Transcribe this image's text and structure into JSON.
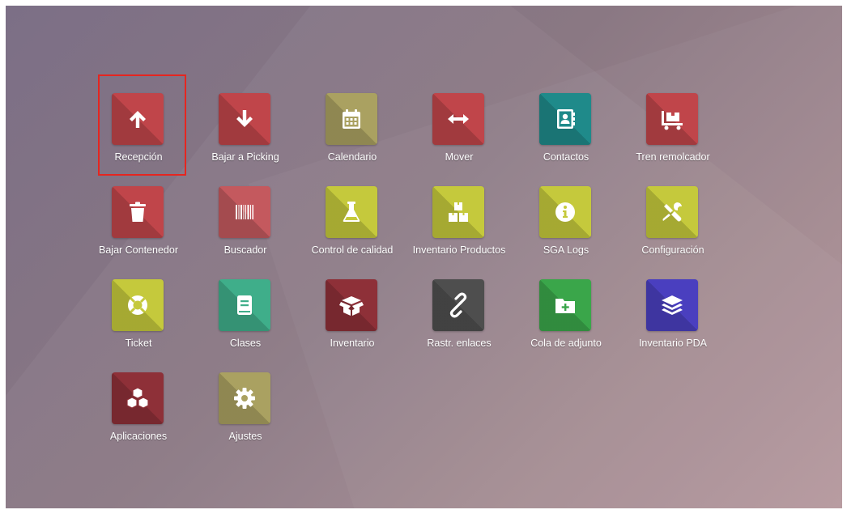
{
  "apps": [
    {
      "label": "Recepción",
      "icon": "arrow-up-icon",
      "color": "#c0454a"
    },
    {
      "label": "Bajar a Picking",
      "icon": "arrow-down-icon",
      "color": "#c0454a"
    },
    {
      "label": "Calendario",
      "icon": "calendar-icon",
      "color": "#aaa161"
    },
    {
      "label": "Mover",
      "icon": "arrows-horizontal-icon",
      "color": "#c0454a"
    },
    {
      "label": "Contactos",
      "icon": "address-book-icon",
      "color": "#1f8a8a"
    },
    {
      "label": "Tren remolcador",
      "icon": "pallet-cart-icon",
      "color": "#c0454a"
    },
    {
      "label": "Bajar Contenedor",
      "icon": "trash-icon",
      "color": "#c0454a"
    },
    {
      "label": "Buscador",
      "icon": "barcode-icon",
      "color": "#c4595e"
    },
    {
      "label": "Control de calidad",
      "icon": "flask-icon",
      "color": "#c5c93c"
    },
    {
      "label": "Inventario Productos",
      "icon": "boxes-icon",
      "color": "#c5c93c"
    },
    {
      "label": "SGA Logs",
      "icon": "info-icon",
      "color": "#c5c93c"
    },
    {
      "label": "Configuración",
      "icon": "tools-icon",
      "color": "#c5c93c"
    },
    {
      "label": "Ticket",
      "icon": "lifebuoy-icon",
      "color": "#c5c93c"
    },
    {
      "label": "Clases",
      "icon": "book-icon",
      "color": "#3fae8a"
    },
    {
      "label": "Inventario",
      "icon": "open-box-icon",
      "color": "#8e3038"
    },
    {
      "label": "Rastr. enlaces",
      "icon": "link-icon",
      "color": "#4e4e4e"
    },
    {
      "label": "Cola de adjunto",
      "icon": "folder-plus-icon",
      "color": "#3aa64a"
    },
    {
      "label": "Inventario PDA",
      "icon": "layers-icon",
      "color": "#4a3fbf"
    },
    {
      "label": "Aplicaciones",
      "icon": "cubes-icon",
      "color": "#8e3038"
    },
    {
      "label": "Ajustes",
      "icon": "gear-icon",
      "color": "#aaa161"
    }
  ],
  "highlighted_app": "Recepción"
}
